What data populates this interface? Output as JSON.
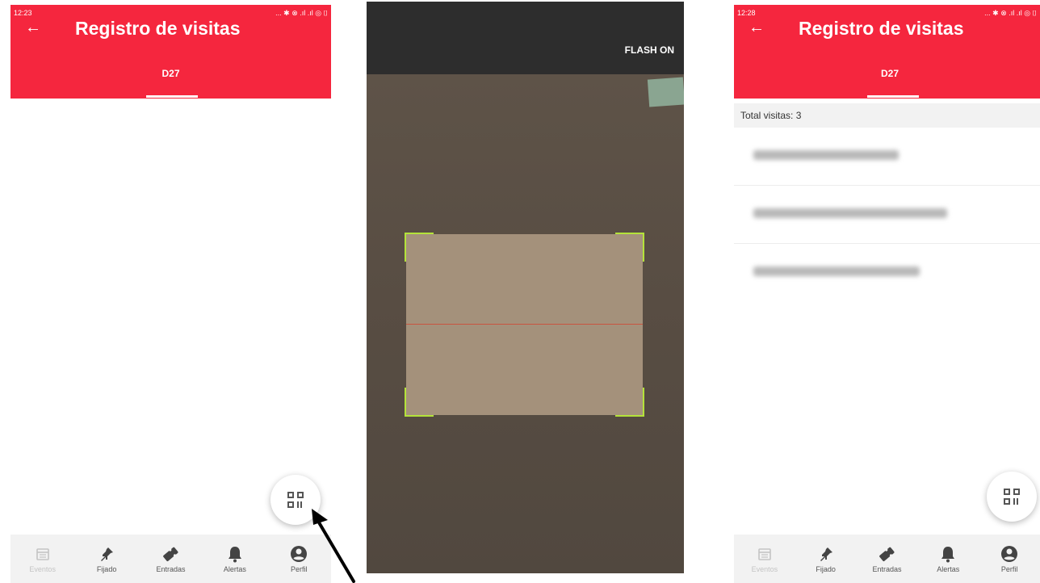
{
  "left": {
    "status_time": "12:23",
    "status_icons": "... ✱ ⊗ .ıl .ıl ◎ ⌷",
    "back_icon": "←",
    "title": "Registro de visitas",
    "tab": "D27"
  },
  "scanner": {
    "flash_label": "FLASH ON"
  },
  "right": {
    "status_time": "12:28",
    "status_icons": "... ✱ ⊗ .ıl .ıl ◎ ⌷",
    "back_icon": "←",
    "title": "Registro de visitas",
    "tab": "D27",
    "total_label": "Total visitas: 3"
  },
  "nav": {
    "items": [
      {
        "label": "Eventos",
        "icon": "calendar-icon",
        "disabled": true
      },
      {
        "label": "Fijado",
        "icon": "pin-icon",
        "disabled": false
      },
      {
        "label": "Entradas",
        "icon": "ticket-icon",
        "disabled": false
      },
      {
        "label": "Alertas",
        "icon": "bell-icon",
        "disabled": false
      },
      {
        "label": "Perfil",
        "icon": "account-icon",
        "disabled": false
      }
    ]
  },
  "colors": {
    "primary": "#f5263e",
    "scan_corner": "#b4e33a",
    "scan_laser": "#c9543f"
  }
}
